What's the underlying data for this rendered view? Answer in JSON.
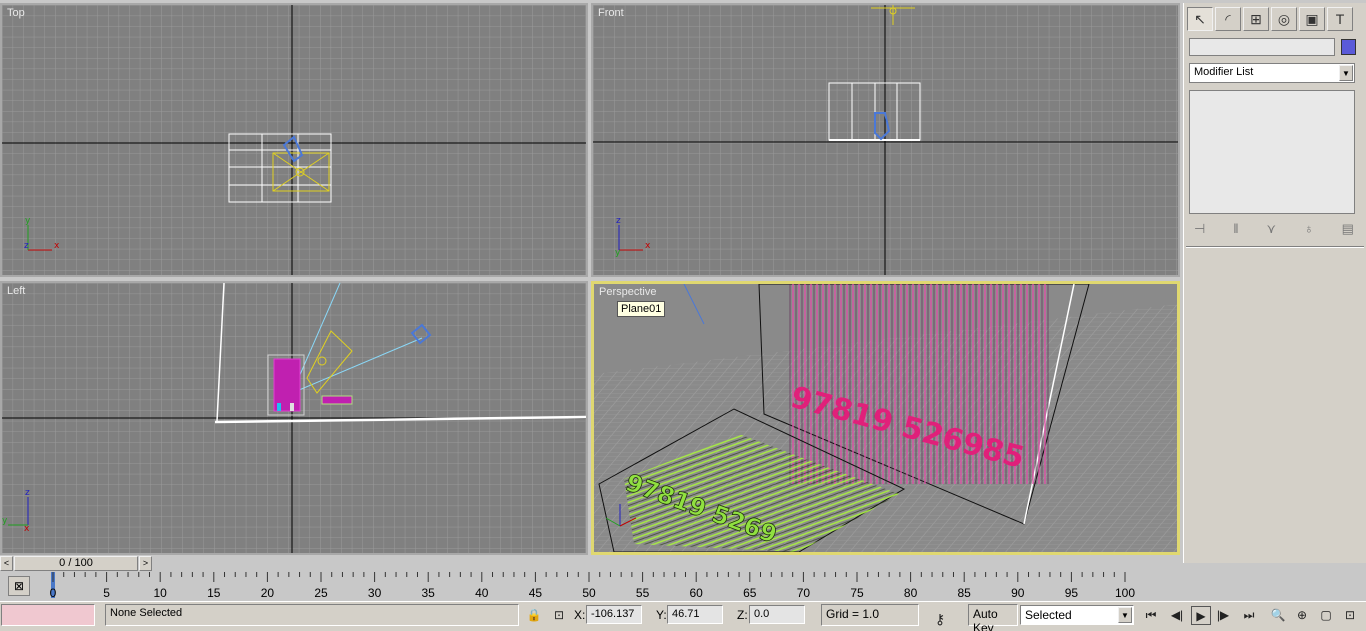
{
  "viewports": {
    "top": {
      "label": "Top"
    },
    "front": {
      "label": "Front"
    },
    "left": {
      "label": "Left"
    },
    "perspective": {
      "label": "Perspective",
      "tooltip": "Plane01",
      "text_red": "97819 526985",
      "text_green": "97819 5269"
    }
  },
  "axes": {
    "x": "x",
    "y": "y",
    "z": "z"
  },
  "command_panel": {
    "tabs": [
      {
        "icon": "create-icon",
        "glyph": "↖"
      },
      {
        "icon": "modify-icon",
        "glyph": "◜"
      },
      {
        "icon": "hierarchy-icon",
        "glyph": "⊞"
      },
      {
        "icon": "motion-icon",
        "glyph": "◎"
      },
      {
        "icon": "display-icon",
        "glyph": "▣"
      },
      {
        "icon": "utilities-icon",
        "glyph": "T"
      }
    ],
    "object_name": "",
    "object_color": "#5a5ad8",
    "modifier_list": "Modifier List",
    "stack_tools": [
      "pin-stack-icon",
      "show-end-result-icon",
      "make-unique-icon",
      "remove-modifier-icon",
      "configure-sets-icon"
    ]
  },
  "time_slider": {
    "position": "0 / 100",
    "prev": "<",
    "next": ">"
  },
  "trackbar": {
    "ticks": [
      "0",
      "5",
      "10",
      "15",
      "20",
      "25",
      "30",
      "35",
      "40",
      "45",
      "50",
      "55",
      "60",
      "65",
      "70",
      "75",
      "80",
      "85",
      "90",
      "95",
      "100"
    ]
  },
  "status": {
    "selection": "None Selected",
    "x_label": "X:",
    "x_value": "-106.137",
    "y_label": "Y:",
    "y_value": "46.71",
    "z_label": "Z:",
    "z_value": "0.0",
    "grid": "Grid = 1.0",
    "auto_key": "Auto Key",
    "key_mode": "Selected"
  },
  "playback": {
    "buttons": [
      "go-to-start-icon",
      "previous-frame-icon",
      "play-icon",
      "next-frame-icon",
      "go-to-end-icon"
    ],
    "glyphs": [
      "⏮",
      "◀|",
      "▶",
      "|▶",
      "⏭"
    ]
  },
  "viewport_nav": {
    "buttons": [
      "zoom-icon",
      "zoom-all-icon",
      "zoom-extents-icon",
      "zoom-extents-all-icon"
    ],
    "glyphs": [
      "🔍",
      "⊕",
      "▢",
      "⊡"
    ]
  },
  "colors": {
    "viewport_bg": "#808080",
    "active_border": "#e0d870",
    "selection_magenta": "#d020b0",
    "text_red": "#e0207a",
    "text_green": "#90e040"
  }
}
